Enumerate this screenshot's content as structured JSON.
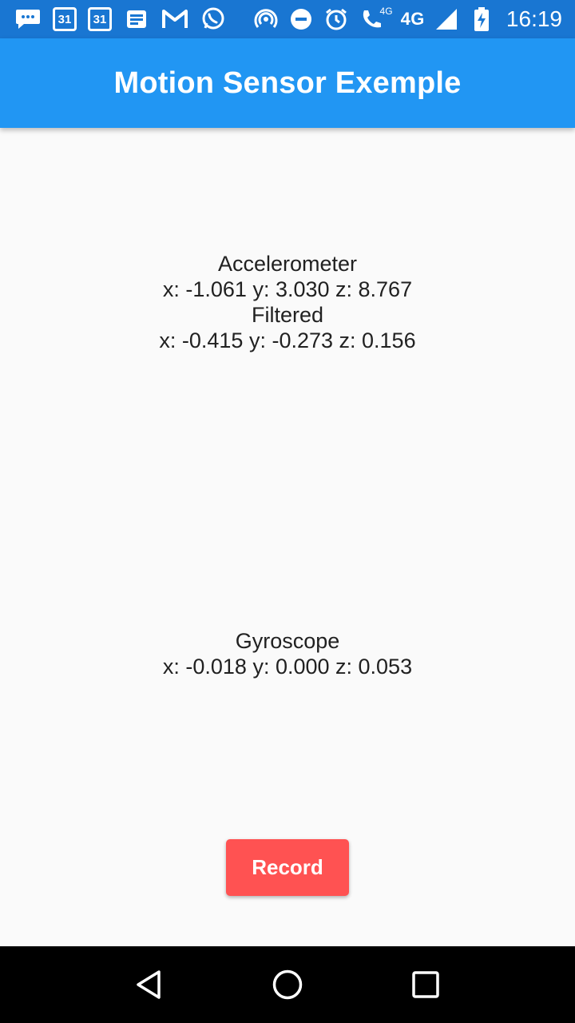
{
  "status_bar": {
    "icons": [
      "chat-bubble-icon",
      "calendar-icon",
      "calendar-icon",
      "message-icon",
      "gmail-icon",
      "whatsapp-icon",
      "hotspot-icon",
      "do-not-disturb-icon",
      "alarm-icon",
      "wifi-calling-icon",
      "signal-icon",
      "battery-charging-icon"
    ],
    "calendar_day_1": "31",
    "calendar_day_2": "31",
    "small_network": "4G",
    "network": "4G",
    "time": "16:19"
  },
  "app_bar": {
    "title": "Motion Sensor Exemple",
    "color": "#2196f3"
  },
  "accelerometer": {
    "heading": "Accelerometer",
    "raw": "x: -1.061 y: 3.030 z: 8.767",
    "filtered_heading": "Filtered",
    "filtered": "x: -0.415 y: -0.273 z: 0.156"
  },
  "gyroscope": {
    "heading": "Gyroscope",
    "values": "x: -0.018 y: 0.000 z: 0.053"
  },
  "record_button": {
    "label": "Record",
    "color": "#ff5252"
  },
  "nav_bar": {
    "icons": [
      "back-icon",
      "home-icon",
      "recents-icon"
    ]
  }
}
